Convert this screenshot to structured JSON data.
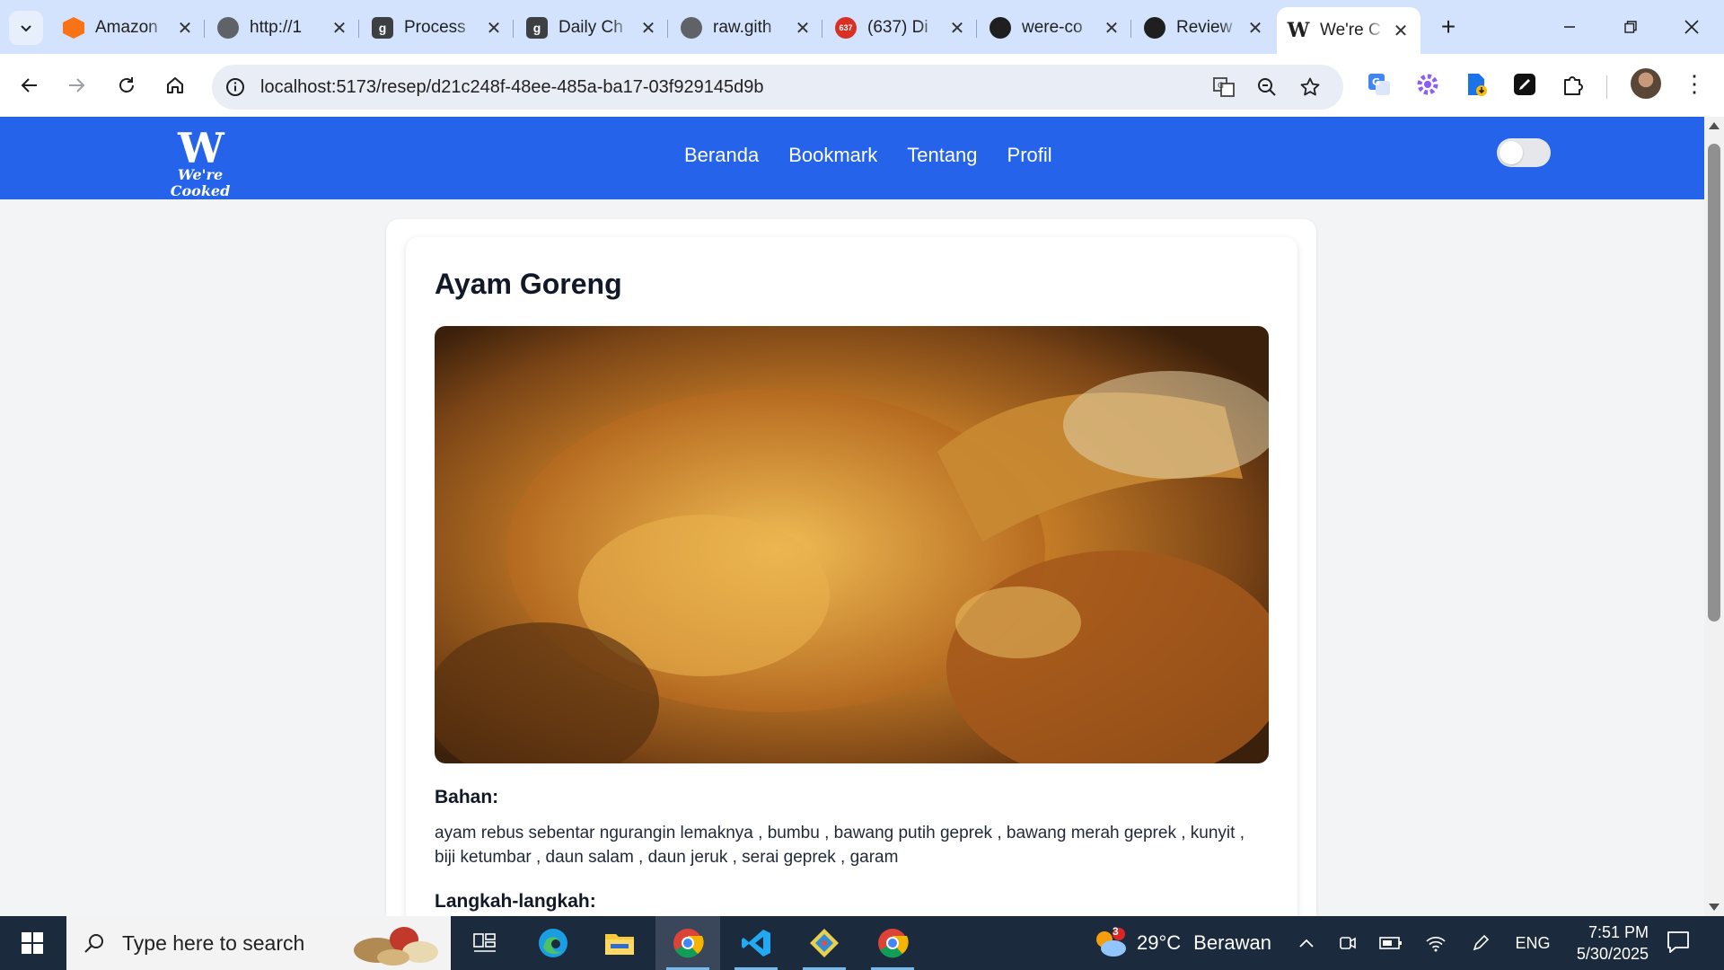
{
  "browser": {
    "tabs": [
      {
        "title": "Amazon",
        "favicon": "amazon-box-icon",
        "color": "#f59e0b"
      },
      {
        "title": "http://1",
        "favicon": "globe-icon",
        "color": "#5f6368"
      },
      {
        "title": "Process",
        "favicon": "g-letter-icon",
        "color": "#3c4043"
      },
      {
        "title": "Daily Ch",
        "favicon": "g-letter-icon",
        "color": "#3c4043"
      },
      {
        "title": "raw.gith",
        "favicon": "globe-icon",
        "color": "#5f6368"
      },
      {
        "title": "(637) Di",
        "favicon": "badge-637-icon",
        "color": "#d93025",
        "badge": "637"
      },
      {
        "title": "were-co",
        "favicon": "github-icon",
        "color": "#1f1f1f"
      },
      {
        "title": "Review",
        "favicon": "openai-icon",
        "color": "#1f1f1f"
      },
      {
        "title": "We're C",
        "favicon": "w-letter-icon",
        "color": "#1f1f1f",
        "active": true
      }
    ],
    "url": "localhost:5173/resep/d21c248f-48ee-485a-ba17-03f929145d9b"
  },
  "site": {
    "logo_main": "W",
    "logo_sub": "We're Cooked",
    "nav": [
      "Beranda",
      "Bookmark",
      "Tentang",
      "Profil"
    ],
    "brand_color": "#2563eb"
  },
  "recipe": {
    "title": "Ayam Goreng",
    "image_subject": "fried-chicken-photo",
    "ingredients_heading": "Bahan:",
    "ingredients": "ayam rebus sebentar ngurangin lemaknya , bumbu , bawang putih geprek , bawang merah geprek , kunyit , biji ketumbar , daun salam , daun jeruk , serai geprek , garam",
    "steps_heading": "Langkah-langkah:"
  },
  "taskbar": {
    "search_placeholder": "Type here to search",
    "weather_temp": "29°C",
    "weather_text": "Berawan",
    "weather_badge": "3",
    "language": "ENG",
    "time": "7:51 PM",
    "date": "5/30/2025"
  }
}
